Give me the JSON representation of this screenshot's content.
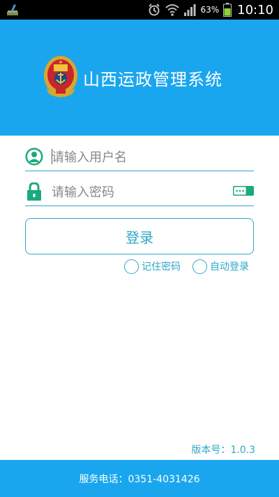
{
  "status_bar": {
    "battery_percent": "63%",
    "time": "10:10",
    "icons": [
      "broom-icon",
      "alarm-icon",
      "wifi-icon",
      "signal-icon",
      "battery-icon"
    ]
  },
  "header": {
    "title": "山西运政管理系统",
    "emblem": "national-emblem-icon",
    "background_color": "#1aa6ee"
  },
  "login_form": {
    "username": {
      "placeholder": "请输入用户名",
      "value": "",
      "icon": "user-icon"
    },
    "password": {
      "placeholder": "请输入密码",
      "value": "",
      "icon": "lock-icon",
      "toggle_icon": "password-visibility-toggle-icon"
    },
    "login_label": "登录",
    "remember_label": "记住密码",
    "auto_login_label": "自动登录",
    "remember_checked": false,
    "auto_login_checked": false
  },
  "version": "版本号：1.0.3",
  "footer": {
    "service_phone": "服务电话：0351-4031426"
  },
  "colors": {
    "primary": "#1aa6ee",
    "accent": "#2ea7c8",
    "icon_green": "#1aaa7e"
  }
}
